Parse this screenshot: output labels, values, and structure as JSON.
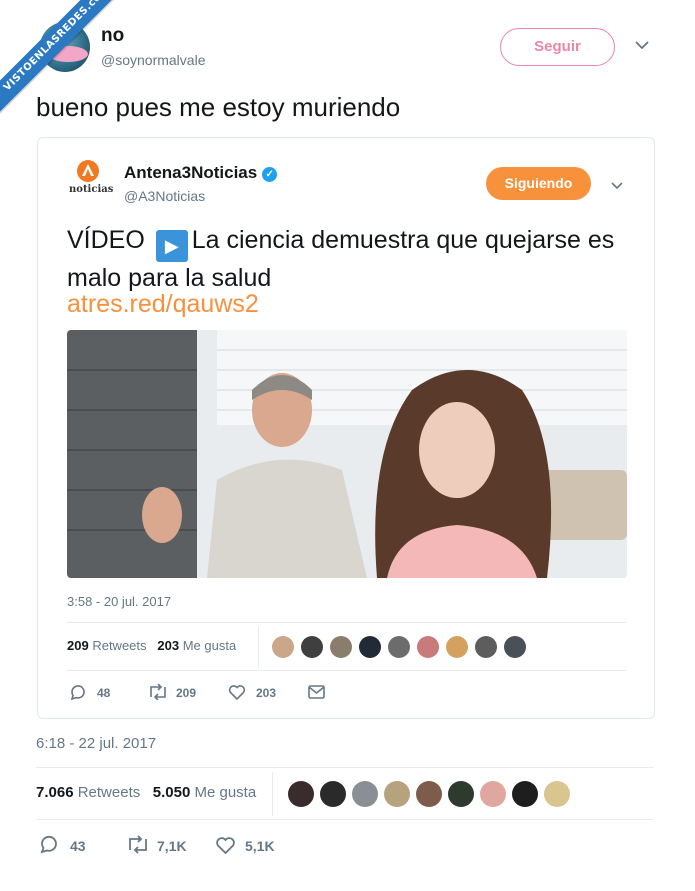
{
  "watermark": "VISTOENLASREDES.com",
  "tweet": {
    "name": "no",
    "handle": "@soynormalvale",
    "follow_label": "Seguir",
    "text": "bueno pues me estoy muriendo",
    "date": "6:18 - 22 jul. 2017",
    "retweets_count": "7.066",
    "retweets_label": "Retweets",
    "likes_count": "5.050",
    "likes_label": "Me gusta",
    "replies": "43",
    "retweets_short": "7,1K",
    "likes_short": "5,1K"
  },
  "quoted": {
    "logo_text": "noticias",
    "name": "Antena3Noticias",
    "handle": "@A3Noticias",
    "follow_label": "Siguiendo",
    "text_prefix": "VÍDEO",
    "text_body": "La ciencia demuestra que quejarse es malo para la salud",
    "link": "atres.red/qauws2",
    "date": "3:58 - 20 jul. 2017",
    "retweets_count": "209",
    "retweets_label": "Retweets",
    "likes_count": "203",
    "likes_label": "Me gusta",
    "replies": "48",
    "retweets_short": "209",
    "likes_short": "203"
  },
  "colors": {
    "accent_orange": "#f7913c",
    "follow_pink": "#e0245e",
    "muted": "#657786",
    "verified_blue": "#1da1f2"
  }
}
